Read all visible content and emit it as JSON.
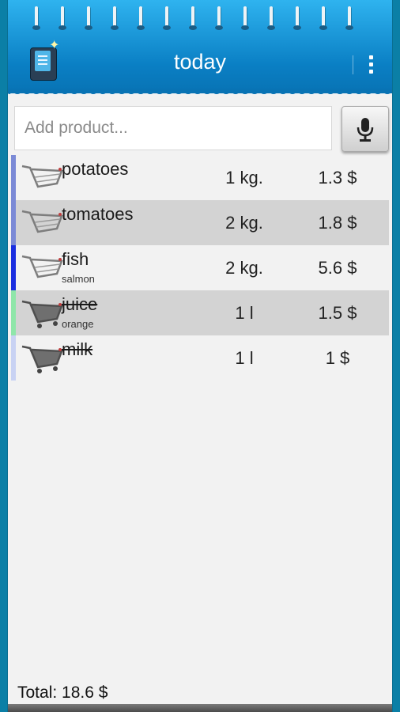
{
  "header": {
    "title": "today",
    "app_icon": "shopping-list-notepad-icon",
    "menu_icon": "overflow-menu-icon"
  },
  "add_product": {
    "placeholder": "Add product...",
    "value": "",
    "voice_icon": "microphone-icon"
  },
  "items": [
    {
      "name": "potatoes",
      "note": "",
      "qty": "1 kg.",
      "price": "1.3 $",
      "purchased": false,
      "bar_color": "#7b8ad6",
      "icon": "cart-outline-icon"
    },
    {
      "name": "tomatoes",
      "note": "",
      "qty": "2 kg.",
      "price": "1.8 $",
      "purchased": false,
      "bar_color": "#7b8ad6",
      "icon": "cart-outline-icon"
    },
    {
      "name": "fish",
      "note": "salmon",
      "qty": "2 kg.",
      "price": "5.6 $",
      "purchased": false,
      "bar_color": "#1a2ee0",
      "icon": "cart-outline-icon"
    },
    {
      "name": "juice",
      "note": "orange",
      "qty": "1 l",
      "price": "1.5 $",
      "purchased": true,
      "bar_color": "#8fe6a9",
      "icon": "cart-filled-icon"
    },
    {
      "name": "milk",
      "note": "",
      "qty": "1 l",
      "price": "1 $",
      "purchased": true,
      "bar_color": "#c8d2f3",
      "icon": "cart-filled-icon"
    }
  ],
  "footer": {
    "total": "Total: 18.6 $"
  },
  "colors": {
    "header_blue": "#0a7fc4",
    "background": "#0b7fa6",
    "row_alt": "#d3d3d3"
  }
}
